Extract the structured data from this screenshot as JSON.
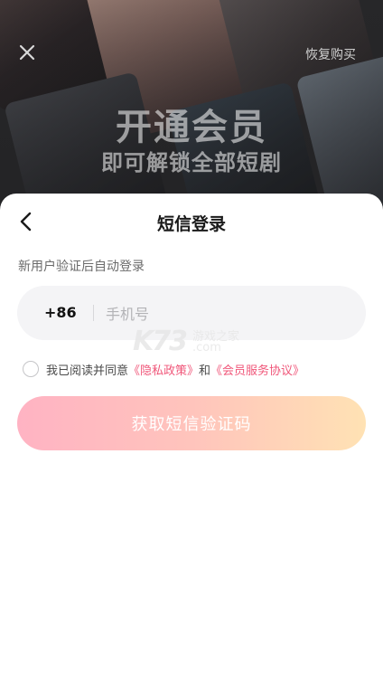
{
  "hero": {
    "restore_label": "恢复购买",
    "title": "开通会员",
    "subtitle": "即可解锁全部短剧"
  },
  "login": {
    "title": "短信登录",
    "hint": "新用户验证后自动登录",
    "country_code": "+86",
    "phone_placeholder": "手机号",
    "phone_value": "",
    "agree_prefix": "我已阅读并同意",
    "privacy_link": "《隐私政策》",
    "agree_and": "和",
    "terms_link": "《会员服务协议》",
    "agree_checked": false,
    "submit_label": "获取短信验证码"
  },
  "icons": {
    "close": "close-icon",
    "back": "chevron-left-icon",
    "checkbox": "circle-checkbox-icon"
  },
  "watermark": {
    "logo": "K73",
    "cn": "游戏之家",
    "com": ".com"
  },
  "colors": {
    "accent_link": "#f0577a",
    "button_gradient_start": "#ffb3c3",
    "button_gradient_end": "#ffe2b4",
    "hero_bg": "#2a2a2c"
  }
}
